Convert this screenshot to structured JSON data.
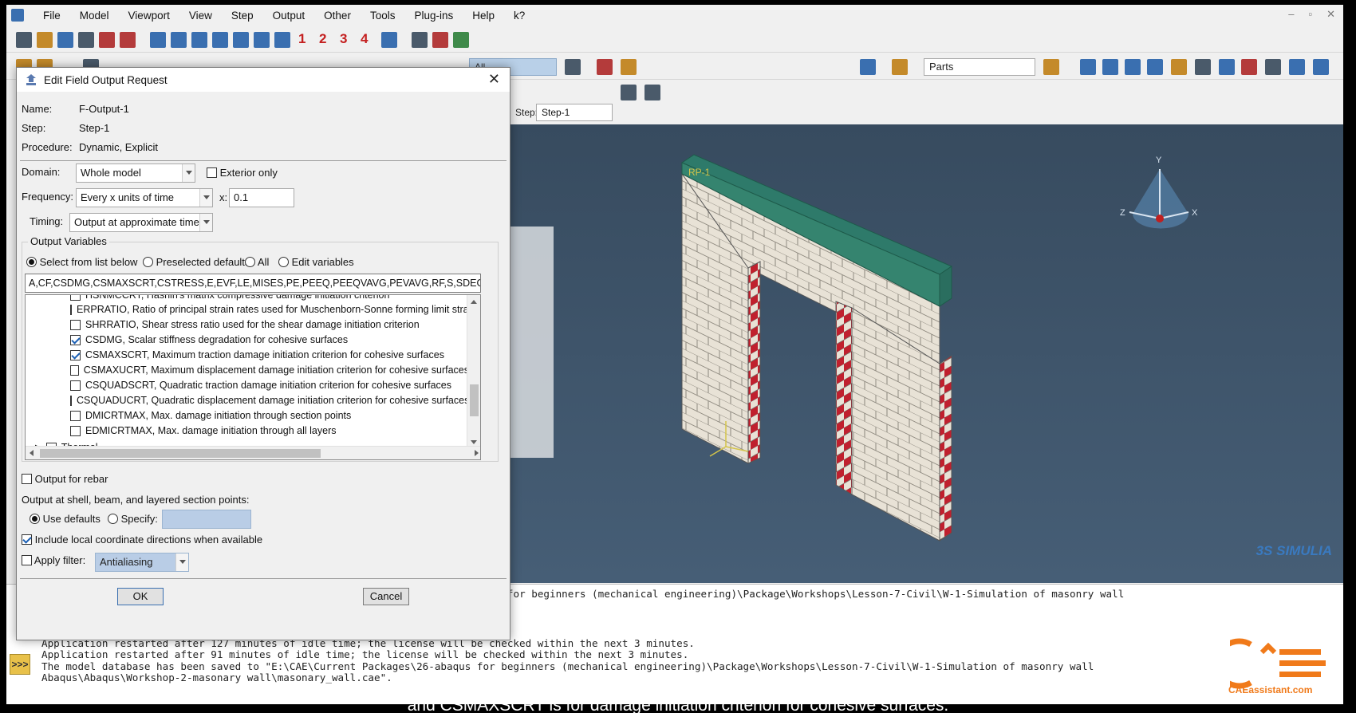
{
  "menu": [
    "File",
    "Model",
    "Viewport",
    "View",
    "Step",
    "Output",
    "Other",
    "Tools",
    "Plug-ins",
    "Help",
    "k?"
  ],
  "window_controls": [
    "–",
    "▫",
    "✕"
  ],
  "toolbar": {
    "step_numbers": [
      "1",
      "2",
      "3",
      "4"
    ],
    "all_combo": "All",
    "parts_combo": "Parts",
    "step_label": "Step:",
    "step_combo": "Step-1"
  },
  "viewport": {
    "label_rp": "RP-1",
    "axis_y": "Y",
    "axis_z": "Z",
    "axis_x": "X",
    "simulia_logo": "3S SIMULIA"
  },
  "dialog": {
    "title": "Edit Field Output Request",
    "info": [
      {
        "key": "Name:",
        "value": "F-Output-1"
      },
      {
        "key": "Step:",
        "value": "Step-1"
      },
      {
        "key": "Procedure:",
        "value": "Dynamic, Explicit"
      }
    ],
    "domain_label": "Domain:",
    "domain_value": "Whole model",
    "exterior_only": "Exterior only",
    "frequency_label": "Frequency:",
    "frequency_value": "Every x units of time",
    "x_label": "x:",
    "x_value": "0.1",
    "timing_label": "Timing:",
    "timing_value": "Output at approximate times",
    "output_variables_label": "Output Variables",
    "radio_options": [
      "Select from list below",
      "Preselected defaults",
      "All",
      "Edit variables"
    ],
    "variable_string": "A,CF,CSDMG,CSMAXSCRT,CSTRESS,E,EVF,LE,MISES,PE,PEEQ,PEEQVAVG,PEVAVG,RF,S,SDEG,SVAVG,U,UT,V",
    "tree_items": [
      {
        "text": "ERPRATIO, Ratio of principal strain rates used for Muschenborn-Sonne forming limit strain",
        "checked": false
      },
      {
        "text": "SHRRATIO, Shear stress ratio used for the shear damage initiation criterion",
        "checked": false
      },
      {
        "text": "CSDMG, Scalar stiffness degradation for cohesive surfaces",
        "checked": true
      },
      {
        "text": "CSMAXSCRT, Maximum traction damage initiation criterion for cohesive surfaces",
        "checked": true
      },
      {
        "text": "CSMAXUCRT, Maximum displacement damage initiation criterion for cohesive surfaces",
        "checked": false
      },
      {
        "text": "CSQUADSCRT, Quadratic traction damage initiation criterion for cohesive surfaces",
        "checked": false
      },
      {
        "text": "CSQUADUCRT, Quadratic displacement damage initiation criterion for cohesive surfaces",
        "checked": false
      },
      {
        "text": "DMICRTMAX, Max. damage initiation through section points",
        "checked": false
      },
      {
        "text": "EDMICRTMAX, Max. damage initiation through all layers",
        "checked": false
      }
    ],
    "tree_partial_top": "HSNMCCRT, Hashin's matrix compressive damage initiation criterion",
    "tree_partial_bottom": "Thermal",
    "output_for_rebar": "Output for rebar",
    "section_points_label": "Output at shell, beam, and layered section points:",
    "use_defaults": "Use defaults",
    "specify": "Specify:",
    "include_local": "Include local coordinate directions when available",
    "apply_filter": "Apply filter:",
    "filter_value": "Antialiasing",
    "ok": "OK",
    "cancel": "Cancel"
  },
  "messages": [
    "Abaqus\\Abaqus\\Workshop-2-masonary wall\\masonary_wall.cae\".",
    "Application restarted after 127 minutes of idle time; the license will be checked within the next 3 minutes.",
    "Application restarted after 91 minutes of idle time; the license will be checked within the next 3 minutes.",
    "The model database has been saved to \"E:\\CAE\\Current Packages\\26-abaqus for beginners (mechanical engineering)\\Package\\Workshops\\Lesson-7-Civil\\W-1-Simulation of masonry wall",
    "Abaqus\\Abaqus\\Workshop-2-masonary wall\\masonary_wall.cae\"."
  ],
  "message_top_right": "aqus for beginners (mechanical engineering)\\Package\\Workshops\\Lesson-7-Civil\\W-1-Simulation of masonry wall",
  "subtitle": "and CSMAXSCRT is for damage initiation criterion for cohesive surfaces.",
  "logo_text": "CAEassistant.com",
  "colors": {
    "brick": "#e8e2d6",
    "red_brick": "#c0202e",
    "lintel": "#2e7a6a",
    "viewport_top": "#374b5f",
    "accent": "#3a6fb0",
    "logo": "#f07a1a"
  }
}
